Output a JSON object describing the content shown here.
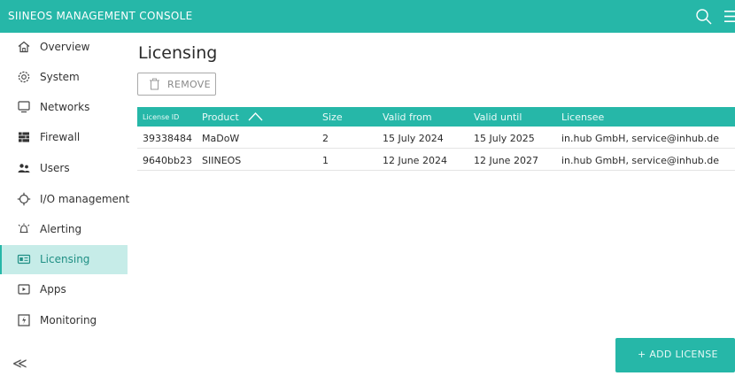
{
  "header": {
    "title": "SIINEOS MANAGEMENT CONSOLE",
    "search_icon": "search-icon",
    "menu_icon": "hamburger-menu-icon"
  },
  "sidebar": {
    "items": [
      {
        "label": "Overview",
        "icon": "home-icon",
        "active": false
      },
      {
        "label": "System",
        "icon": "gear-icon",
        "active": false
      },
      {
        "label": "Networks",
        "icon": "monitor-icon",
        "active": false
      },
      {
        "label": "Firewall",
        "icon": "firewall-icon",
        "active": false
      },
      {
        "label": "Users",
        "icon": "users-icon",
        "active": false
      },
      {
        "label": "I/O management",
        "icon": "io-icon",
        "active": false
      },
      {
        "label": "Alerting",
        "icon": "alert-icon",
        "active": false
      },
      {
        "label": "Licensing",
        "icon": "license-icon",
        "active": true
      },
      {
        "label": "Apps",
        "icon": "apps-icon",
        "active": false
      },
      {
        "label": "Monitoring",
        "icon": "monitoring-icon",
        "active": false
      }
    ],
    "collapse_symbol": "≪"
  },
  "main": {
    "title": "Licensing",
    "remove_label": "REMOVE",
    "add_label": "+ ADD LICENSE",
    "table": {
      "columns": [
        "License ID",
        "Product",
        "Size",
        "Valid from",
        "Valid until",
        "Licensee"
      ],
      "sorted_column": "Product",
      "rows": [
        [
          "39338484",
          "MaDoW",
          "2",
          "15 July 2024",
          "15 July 2025",
          "in.hub GmbH, service@inhub.de"
        ],
        [
          "9640bb23",
          "SIINEOS",
          "1",
          "12 June 2024",
          "12 June 2027",
          "in.hub GmbH, service@inhub.de"
        ]
      ]
    }
  },
  "colors": {
    "accent": "#26b7a8",
    "active_bg": "#c6ece8"
  }
}
